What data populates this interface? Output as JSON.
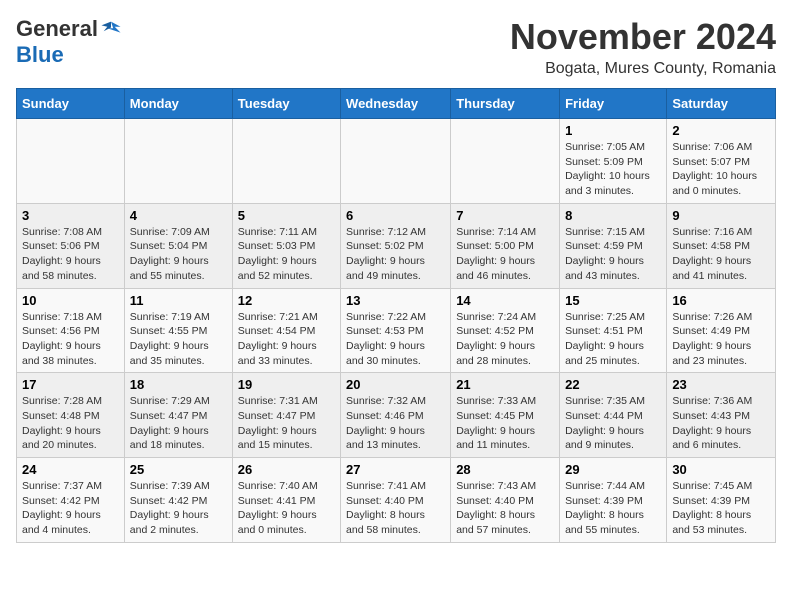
{
  "header": {
    "logo_general": "General",
    "logo_blue": "Blue",
    "month_title": "November 2024",
    "location": "Bogata, Mures County, Romania"
  },
  "days_of_week": [
    "Sunday",
    "Monday",
    "Tuesday",
    "Wednesday",
    "Thursday",
    "Friday",
    "Saturday"
  ],
  "weeks": [
    [
      {
        "day": "",
        "info": ""
      },
      {
        "day": "",
        "info": ""
      },
      {
        "day": "",
        "info": ""
      },
      {
        "day": "",
        "info": ""
      },
      {
        "day": "",
        "info": ""
      },
      {
        "day": "1",
        "info": "Sunrise: 7:05 AM\nSunset: 5:09 PM\nDaylight: 10 hours and 3 minutes."
      },
      {
        "day": "2",
        "info": "Sunrise: 7:06 AM\nSunset: 5:07 PM\nDaylight: 10 hours and 0 minutes."
      }
    ],
    [
      {
        "day": "3",
        "info": "Sunrise: 7:08 AM\nSunset: 5:06 PM\nDaylight: 9 hours and 58 minutes."
      },
      {
        "day": "4",
        "info": "Sunrise: 7:09 AM\nSunset: 5:04 PM\nDaylight: 9 hours and 55 minutes."
      },
      {
        "day": "5",
        "info": "Sunrise: 7:11 AM\nSunset: 5:03 PM\nDaylight: 9 hours and 52 minutes."
      },
      {
        "day": "6",
        "info": "Sunrise: 7:12 AM\nSunset: 5:02 PM\nDaylight: 9 hours and 49 minutes."
      },
      {
        "day": "7",
        "info": "Sunrise: 7:14 AM\nSunset: 5:00 PM\nDaylight: 9 hours and 46 minutes."
      },
      {
        "day": "8",
        "info": "Sunrise: 7:15 AM\nSunset: 4:59 PM\nDaylight: 9 hours and 43 minutes."
      },
      {
        "day": "9",
        "info": "Sunrise: 7:16 AM\nSunset: 4:58 PM\nDaylight: 9 hours and 41 minutes."
      }
    ],
    [
      {
        "day": "10",
        "info": "Sunrise: 7:18 AM\nSunset: 4:56 PM\nDaylight: 9 hours and 38 minutes."
      },
      {
        "day": "11",
        "info": "Sunrise: 7:19 AM\nSunset: 4:55 PM\nDaylight: 9 hours and 35 minutes."
      },
      {
        "day": "12",
        "info": "Sunrise: 7:21 AM\nSunset: 4:54 PM\nDaylight: 9 hours and 33 minutes."
      },
      {
        "day": "13",
        "info": "Sunrise: 7:22 AM\nSunset: 4:53 PM\nDaylight: 9 hours and 30 minutes."
      },
      {
        "day": "14",
        "info": "Sunrise: 7:24 AM\nSunset: 4:52 PM\nDaylight: 9 hours and 28 minutes."
      },
      {
        "day": "15",
        "info": "Sunrise: 7:25 AM\nSunset: 4:51 PM\nDaylight: 9 hours and 25 minutes."
      },
      {
        "day": "16",
        "info": "Sunrise: 7:26 AM\nSunset: 4:49 PM\nDaylight: 9 hours and 23 minutes."
      }
    ],
    [
      {
        "day": "17",
        "info": "Sunrise: 7:28 AM\nSunset: 4:48 PM\nDaylight: 9 hours and 20 minutes."
      },
      {
        "day": "18",
        "info": "Sunrise: 7:29 AM\nSunset: 4:47 PM\nDaylight: 9 hours and 18 minutes."
      },
      {
        "day": "19",
        "info": "Sunrise: 7:31 AM\nSunset: 4:47 PM\nDaylight: 9 hours and 15 minutes."
      },
      {
        "day": "20",
        "info": "Sunrise: 7:32 AM\nSunset: 4:46 PM\nDaylight: 9 hours and 13 minutes."
      },
      {
        "day": "21",
        "info": "Sunrise: 7:33 AM\nSunset: 4:45 PM\nDaylight: 9 hours and 11 minutes."
      },
      {
        "day": "22",
        "info": "Sunrise: 7:35 AM\nSunset: 4:44 PM\nDaylight: 9 hours and 9 minutes."
      },
      {
        "day": "23",
        "info": "Sunrise: 7:36 AM\nSunset: 4:43 PM\nDaylight: 9 hours and 6 minutes."
      }
    ],
    [
      {
        "day": "24",
        "info": "Sunrise: 7:37 AM\nSunset: 4:42 PM\nDaylight: 9 hours and 4 minutes."
      },
      {
        "day": "25",
        "info": "Sunrise: 7:39 AM\nSunset: 4:42 PM\nDaylight: 9 hours and 2 minutes."
      },
      {
        "day": "26",
        "info": "Sunrise: 7:40 AM\nSunset: 4:41 PM\nDaylight: 9 hours and 0 minutes."
      },
      {
        "day": "27",
        "info": "Sunrise: 7:41 AM\nSunset: 4:40 PM\nDaylight: 8 hours and 58 minutes."
      },
      {
        "day": "28",
        "info": "Sunrise: 7:43 AM\nSunset: 4:40 PM\nDaylight: 8 hours and 57 minutes."
      },
      {
        "day": "29",
        "info": "Sunrise: 7:44 AM\nSunset: 4:39 PM\nDaylight: 8 hours and 55 minutes."
      },
      {
        "day": "30",
        "info": "Sunrise: 7:45 AM\nSunset: 4:39 PM\nDaylight: 8 hours and 53 minutes."
      }
    ]
  ]
}
